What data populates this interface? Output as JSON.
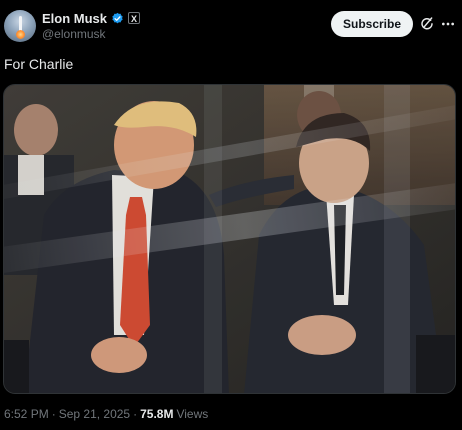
{
  "post": {
    "author": {
      "display_name": "Elon Musk",
      "handle": "@elonmusk",
      "verified_color": "#1d9bf0",
      "affiliate_badge": "X"
    },
    "subscribe_label": "Subscribe",
    "text": "For Charlie",
    "media": {
      "type": "photo"
    },
    "meta": {
      "time": "6:52 PM",
      "sep1": "·",
      "date": "Sep 21, 2025",
      "sep2": "·",
      "views_count": "75.8M",
      "views_label": "Views"
    }
  },
  "icons": {
    "verified": "verified-badge-icon",
    "grok": "grok-icon",
    "more": "more-horizontal-icon"
  }
}
